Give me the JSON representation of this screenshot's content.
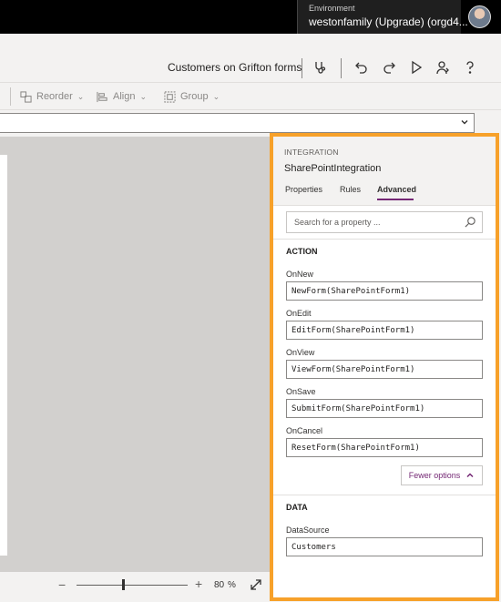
{
  "topbar": {
    "environment_label": "Environment",
    "environment_name": "westonfamily (Upgrade) (orgd4..."
  },
  "titlebar": {
    "app_title": "Customers on Grifton forms"
  },
  "ribbon": {
    "reorder_label": "Reorder",
    "align_label": "Align",
    "group_label": "Group"
  },
  "zoom": {
    "value": "80",
    "unit": "%",
    "minus": "−",
    "plus": "+"
  },
  "panel": {
    "section": "INTEGRATION",
    "name": "SharePointIntegration",
    "tabs": [
      "Properties",
      "Rules",
      "Advanced"
    ],
    "active_tab": "Advanced",
    "search_placeholder": "Search for a property ...",
    "action_group": "ACTION",
    "action_props": [
      {
        "label": "OnNew",
        "value": "NewForm(SharePointForm1)"
      },
      {
        "label": "OnEdit",
        "value": "EditForm(SharePointForm1)"
      },
      {
        "label": "OnView",
        "value": "ViewForm(SharePointForm1)"
      },
      {
        "label": "OnSave",
        "value": "SubmitForm(SharePointForm1)"
      },
      {
        "label": "OnCancel",
        "value": "ResetForm(SharePointForm1)"
      }
    ],
    "fewer_options": "Fewer options",
    "data_group": "DATA",
    "data_props": [
      {
        "label": "DataSource",
        "value": "Customers"
      }
    ]
  },
  "colors": {
    "highlight_border": "#f7a12a",
    "accent": "#742774"
  }
}
